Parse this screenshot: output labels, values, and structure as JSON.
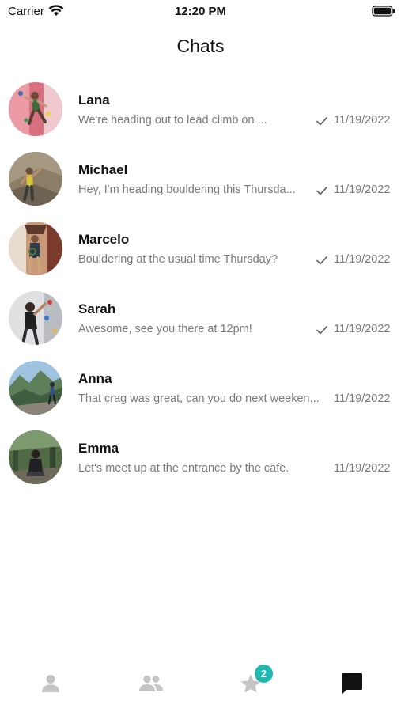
{
  "status_bar": {
    "carrier": "Carrier",
    "time": "12:20 PM"
  },
  "header": {
    "title": "Chats"
  },
  "chats": [
    {
      "name": "Lana",
      "preview": "We're heading out to lead climb on ...",
      "date": "11/19/2022",
      "read": true
    },
    {
      "name": "Michael",
      "preview": "Hey, I'm heading bouldering this Thursda...",
      "date": "11/19/2022",
      "read": true
    },
    {
      "name": "Marcelo",
      "preview": "Bouldering at the usual time Thursday?",
      "date": "11/19/2022",
      "read": true
    },
    {
      "name": "Sarah",
      "preview": "Awesome, see you there at 12pm!",
      "date": "11/19/2022",
      "read": true
    },
    {
      "name": "Anna",
      "preview": "That crag was great, can you do next weeken...",
      "date": "11/19/2022",
      "read": false
    },
    {
      "name": "Emma",
      "preview": "Let's meet up at the entrance by the cafe.",
      "date": "11/19/2022",
      "read": false
    }
  ],
  "tab_bar": {
    "tabs": [
      {
        "icon": "person-icon",
        "active": false
      },
      {
        "icon": "people-icon",
        "active": false
      },
      {
        "icon": "star-icon",
        "active": false
      },
      {
        "icon": "chat-bubble-icon",
        "active": true
      }
    ],
    "favorites_badge": "2"
  },
  "colors": {
    "badge": "#1fb8b0",
    "inactive_icon": "#c4c4c4",
    "active_icon": "#111111",
    "secondary_text": "#7a7a7a"
  }
}
